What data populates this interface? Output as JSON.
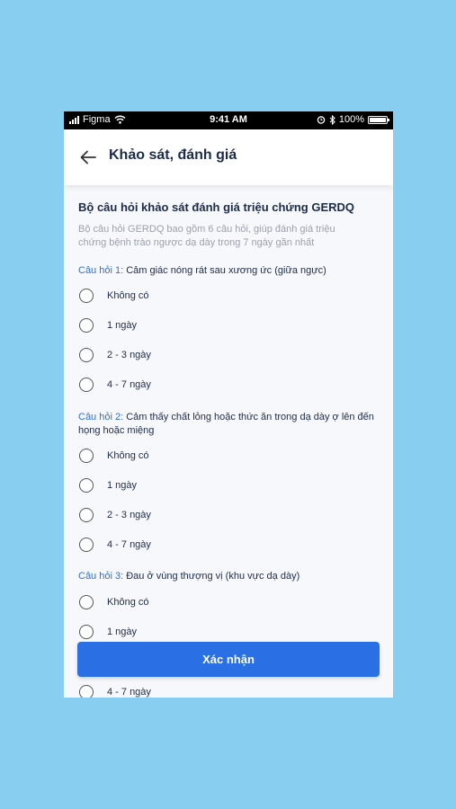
{
  "status_bar": {
    "carrier": "Figma",
    "time": "9:41 AM",
    "battery": "100%"
  },
  "header": {
    "title": "Khảo sát, đánh giá"
  },
  "survey": {
    "title": "Bộ câu hỏi khảo sát đánh giá triệu chứng GERDQ",
    "description": "Bộ câu hỏi GERDQ bao gồm 6 câu hỏi, giúp đánh giá triệu chứng bệnh trào ngược dạ dày trong 7 ngày gần nhất"
  },
  "questions": [
    {
      "label": "Câu hỏi 1:",
      "text": " Cảm giác nóng rát sau xương ức (giữa ngực)",
      "options": [
        "Không có",
        "1 ngày",
        "2 - 3 ngày",
        "4 - 7 ngày"
      ]
    },
    {
      "label": "Câu hỏi 2:",
      "text": " Cảm thấy chất lỏng hoặc thức ăn trong dạ dày ợ lên đến họng hoặc miệng",
      "options": [
        "Không có",
        "1 ngày",
        "2 - 3 ngày",
        "4 - 7 ngày"
      ]
    },
    {
      "label": "Câu hỏi 3:",
      "text": " Đau ở vùng thượng vị (khu vực dạ dày)",
      "options": [
        "Không có",
        "1 ngày",
        "4 - 7 ngày"
      ]
    }
  ],
  "confirm_button": "Xác nhận",
  "colors": {
    "accent": "#2a6fe3",
    "background": "#87CEF0",
    "text": "#1c2b4a",
    "muted": "#9aa0ad"
  }
}
